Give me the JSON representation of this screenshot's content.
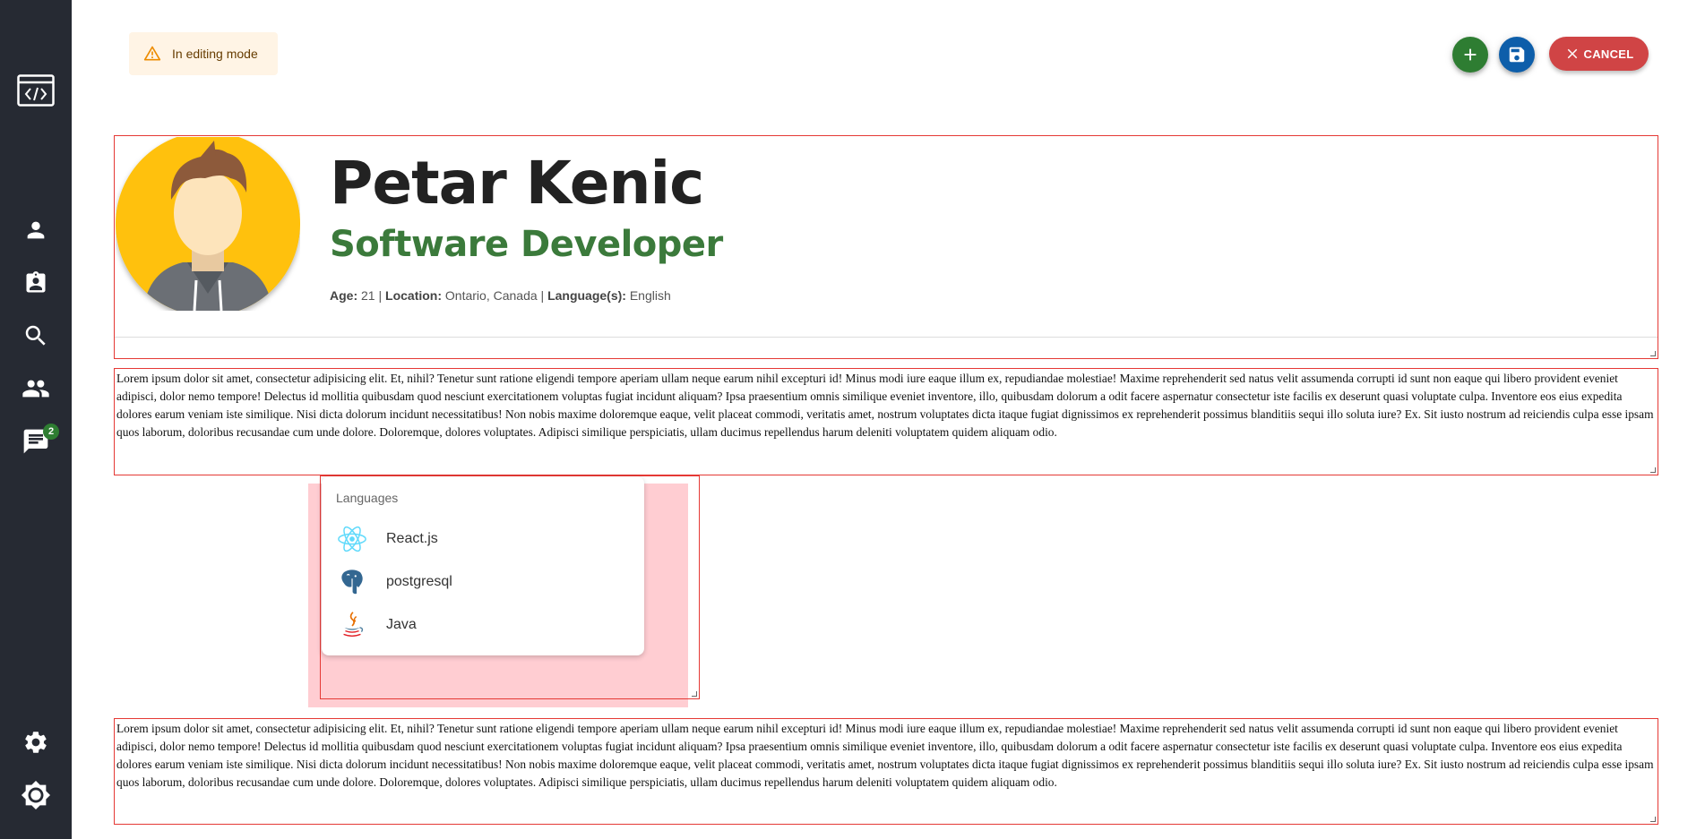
{
  "sidebar": {
    "items": [
      {
        "icon": "code-window-icon"
      },
      {
        "icon": "person-icon"
      },
      {
        "icon": "clipboard-user-icon"
      },
      {
        "icon": "search-icon"
      },
      {
        "icon": "people-icon"
      },
      {
        "icon": "chat-icon",
        "badge": "2"
      },
      {
        "icon": "gear-icon"
      },
      {
        "icon": "brightness-icon"
      }
    ]
  },
  "alert": {
    "text": "In editing mode",
    "icon": "warning-icon"
  },
  "actions": {
    "add_icon": "plus-icon",
    "save_icon": "save-icon",
    "cancel_label": "CANCEL"
  },
  "profile": {
    "name": "Petar Kenic",
    "role": "Software Developer",
    "age_label": "Age:",
    "age": "21",
    "location_label": "Location:",
    "location": "Ontario, Canada",
    "languages_label": "Language(s):",
    "languages": "English",
    "separator": "|"
  },
  "text_blocks": [
    "Lorem ipsum dolor sit amet, consectetur adipisicing elit. Et, nihil? Tenetur sunt ratione eligendi tempore aperiam ullam neque earum nihil excepturi id! Minus modi iure eaque illum ex, repudiandae molestiae! Maxime reprehenderit sed natus velit assumenda corrupti id sunt non eaque qui libero provident eveniet adipisci, dolor nemo tempore! Delectus id mollitia quibusdam quod nesciunt exercitationem voluptas fugiat incidunt aliquam? Ipsa praesentium omnis similique eveniet inventore, illo, quibusdam dolorum a odit facere aspernatur consectetur iste facilis ex deserunt quasi voluptate culpa. Inventore eos eius expedita dolores earum veniam iste similique. Nisi dicta dolorum incidunt necessitatibus! Non nobis maxime doloremque eaque, velit placeat commodi, veritatis amet, nostrum voluptates dicta itaque fugiat dignissimos ex reprehenderit possimus blanditiis sequi illo soluta iure? Ex. Sit iusto nostrum ad reiciendis culpa esse ipsam quos laborum, doloribus recusandae cum unde dolore. Doloremque, dolores voluptates. Adipisci similique perspiciatis, ullam ducimus repellendus harum deleniti voluptatem quidem aliquam odio.",
    "Lorem ipsum dolor sit amet, consectetur adipisicing elit. Et, nihil? Tenetur sunt ratione eligendi tempore aperiam ullam neque earum nihil excepturi id! Minus modi iure eaque illum ex, repudiandae molestiae! Maxime reprehenderit sed natus velit assumenda corrupti id sunt non eaque qui libero provident eveniet adipisci, dolor nemo tempore! Delectus id mollitia quibusdam quod nesciunt exercitationem voluptas fugiat incidunt aliquam? Ipsa praesentium omnis similique eveniet inventore, illo, quibusdam dolorum a odit facere aspernatur consectetur iste facilis ex deserunt quasi voluptate culpa. Inventore eos eius expedita dolores earum veniam iste similique. Nisi dicta dolorum incidunt necessitatibus! Non nobis maxime doloremque eaque, velit placeat commodi, veritatis amet, nostrum voluptates dicta itaque fugiat dignissimos ex reprehenderit possimus blanditiis sequi illo soluta iure? Ex. Sit iusto nostrum ad reiciendis culpa esse ipsam quos laborum, doloribus recusandae cum unde dolore. Doloremque, dolores voluptates. Adipisci similique perspiciatis, ullam ducimus repellendus harum deleniti voluptatem quidem aliquam odio."
  ],
  "languages_card": {
    "title": "Languages",
    "items": [
      {
        "label": "React.js",
        "icon": "react-icon"
      },
      {
        "label": "postgresql",
        "icon": "postgresql-icon"
      },
      {
        "label": "Java",
        "icon": "java-icon"
      }
    ]
  },
  "colors": {
    "sidebar_bg": "#262a33",
    "role_green": "#3b7a3b",
    "add_button": "#2e7d32",
    "save_button": "#0d5eaa",
    "cancel_button": "#d04445",
    "outline_red": "#e53935",
    "alert_bg": "#fff4e5"
  }
}
